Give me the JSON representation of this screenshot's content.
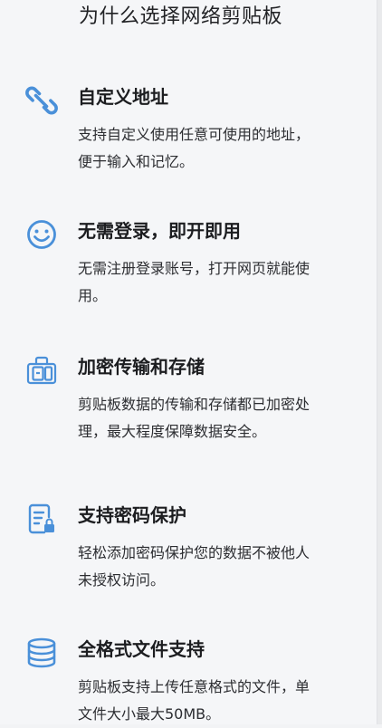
{
  "section": {
    "title": "为什么选择网络剪贴板"
  },
  "features": [
    {
      "icon": "link-icon",
      "title": "自定义地址",
      "description": "支持自定义使用任意可使用的地址，便于输入和记忆。"
    },
    {
      "icon": "smiley-icon",
      "title": "无需登录，即开即用",
      "description": "无需注册登录账号，打开网页就能使用。"
    },
    {
      "icon": "luggage-icon",
      "title": "加密传输和存储",
      "description": "剪贴板数据的传输和存储都已加密处理，最大程度保障数据安全。"
    },
    {
      "icon": "document-lock-icon",
      "title": "支持密码保护",
      "description": "轻松添加密码保护您的数据不被他人未授权访问。"
    },
    {
      "icon": "database-icon",
      "title": "全格式文件支持",
      "description": "剪贴板支持上传任意格式的文件，单文件大小最大50MB。"
    }
  ],
  "colors": {
    "accent": "#4a90d9",
    "background": "#f5f6f8",
    "text": "#1c1d20"
  }
}
